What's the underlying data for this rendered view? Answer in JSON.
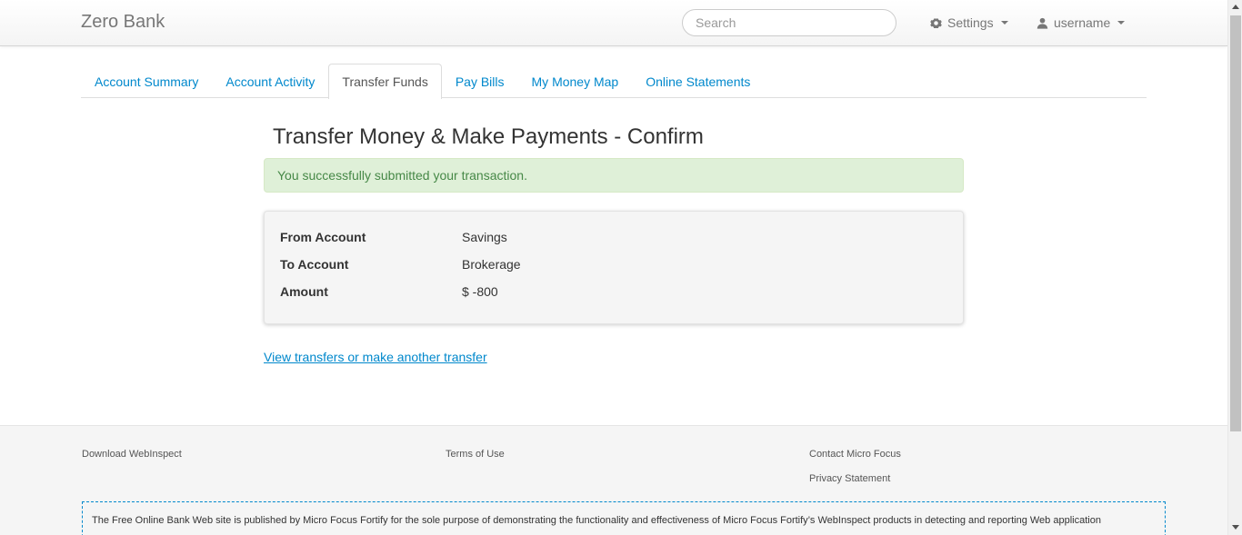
{
  "navbar": {
    "brand": "Zero Bank",
    "search_placeholder": "Search",
    "settings_label": "Settings",
    "user_label": "username"
  },
  "tabs": [
    {
      "label": "Account Summary",
      "active": false
    },
    {
      "label": "Account Activity",
      "active": false
    },
    {
      "label": "Transfer Funds",
      "active": true
    },
    {
      "label": "Pay Bills",
      "active": false
    },
    {
      "label": "My Money Map",
      "active": false
    },
    {
      "label": "Online Statements",
      "active": false
    }
  ],
  "main": {
    "title": "Transfer Money & Make Payments - Confirm",
    "alert": "You successfully submitted your transaction.",
    "details": [
      {
        "label": "From Account",
        "value": "Savings"
      },
      {
        "label": "To Account",
        "value": "Brokerage"
      },
      {
        "label": "Amount",
        "value": "$ -800"
      }
    ],
    "link": "View transfers or make another transfer"
  },
  "footer": {
    "download": "Download WebInspect",
    "terms": "Terms of Use",
    "contact": "Contact Micro Focus",
    "privacy": "Privacy Statement",
    "disclaimer": "The Free Online Bank Web site is published by Micro Focus Fortify for the sole purpose of demonstrating the functionality and effectiveness of Micro Focus Fortify’s WebInspect products in detecting and reporting Web application"
  },
  "colors": {
    "link": "#0088cc",
    "alert_bg": "#dff0d8",
    "alert_text": "#468847"
  }
}
